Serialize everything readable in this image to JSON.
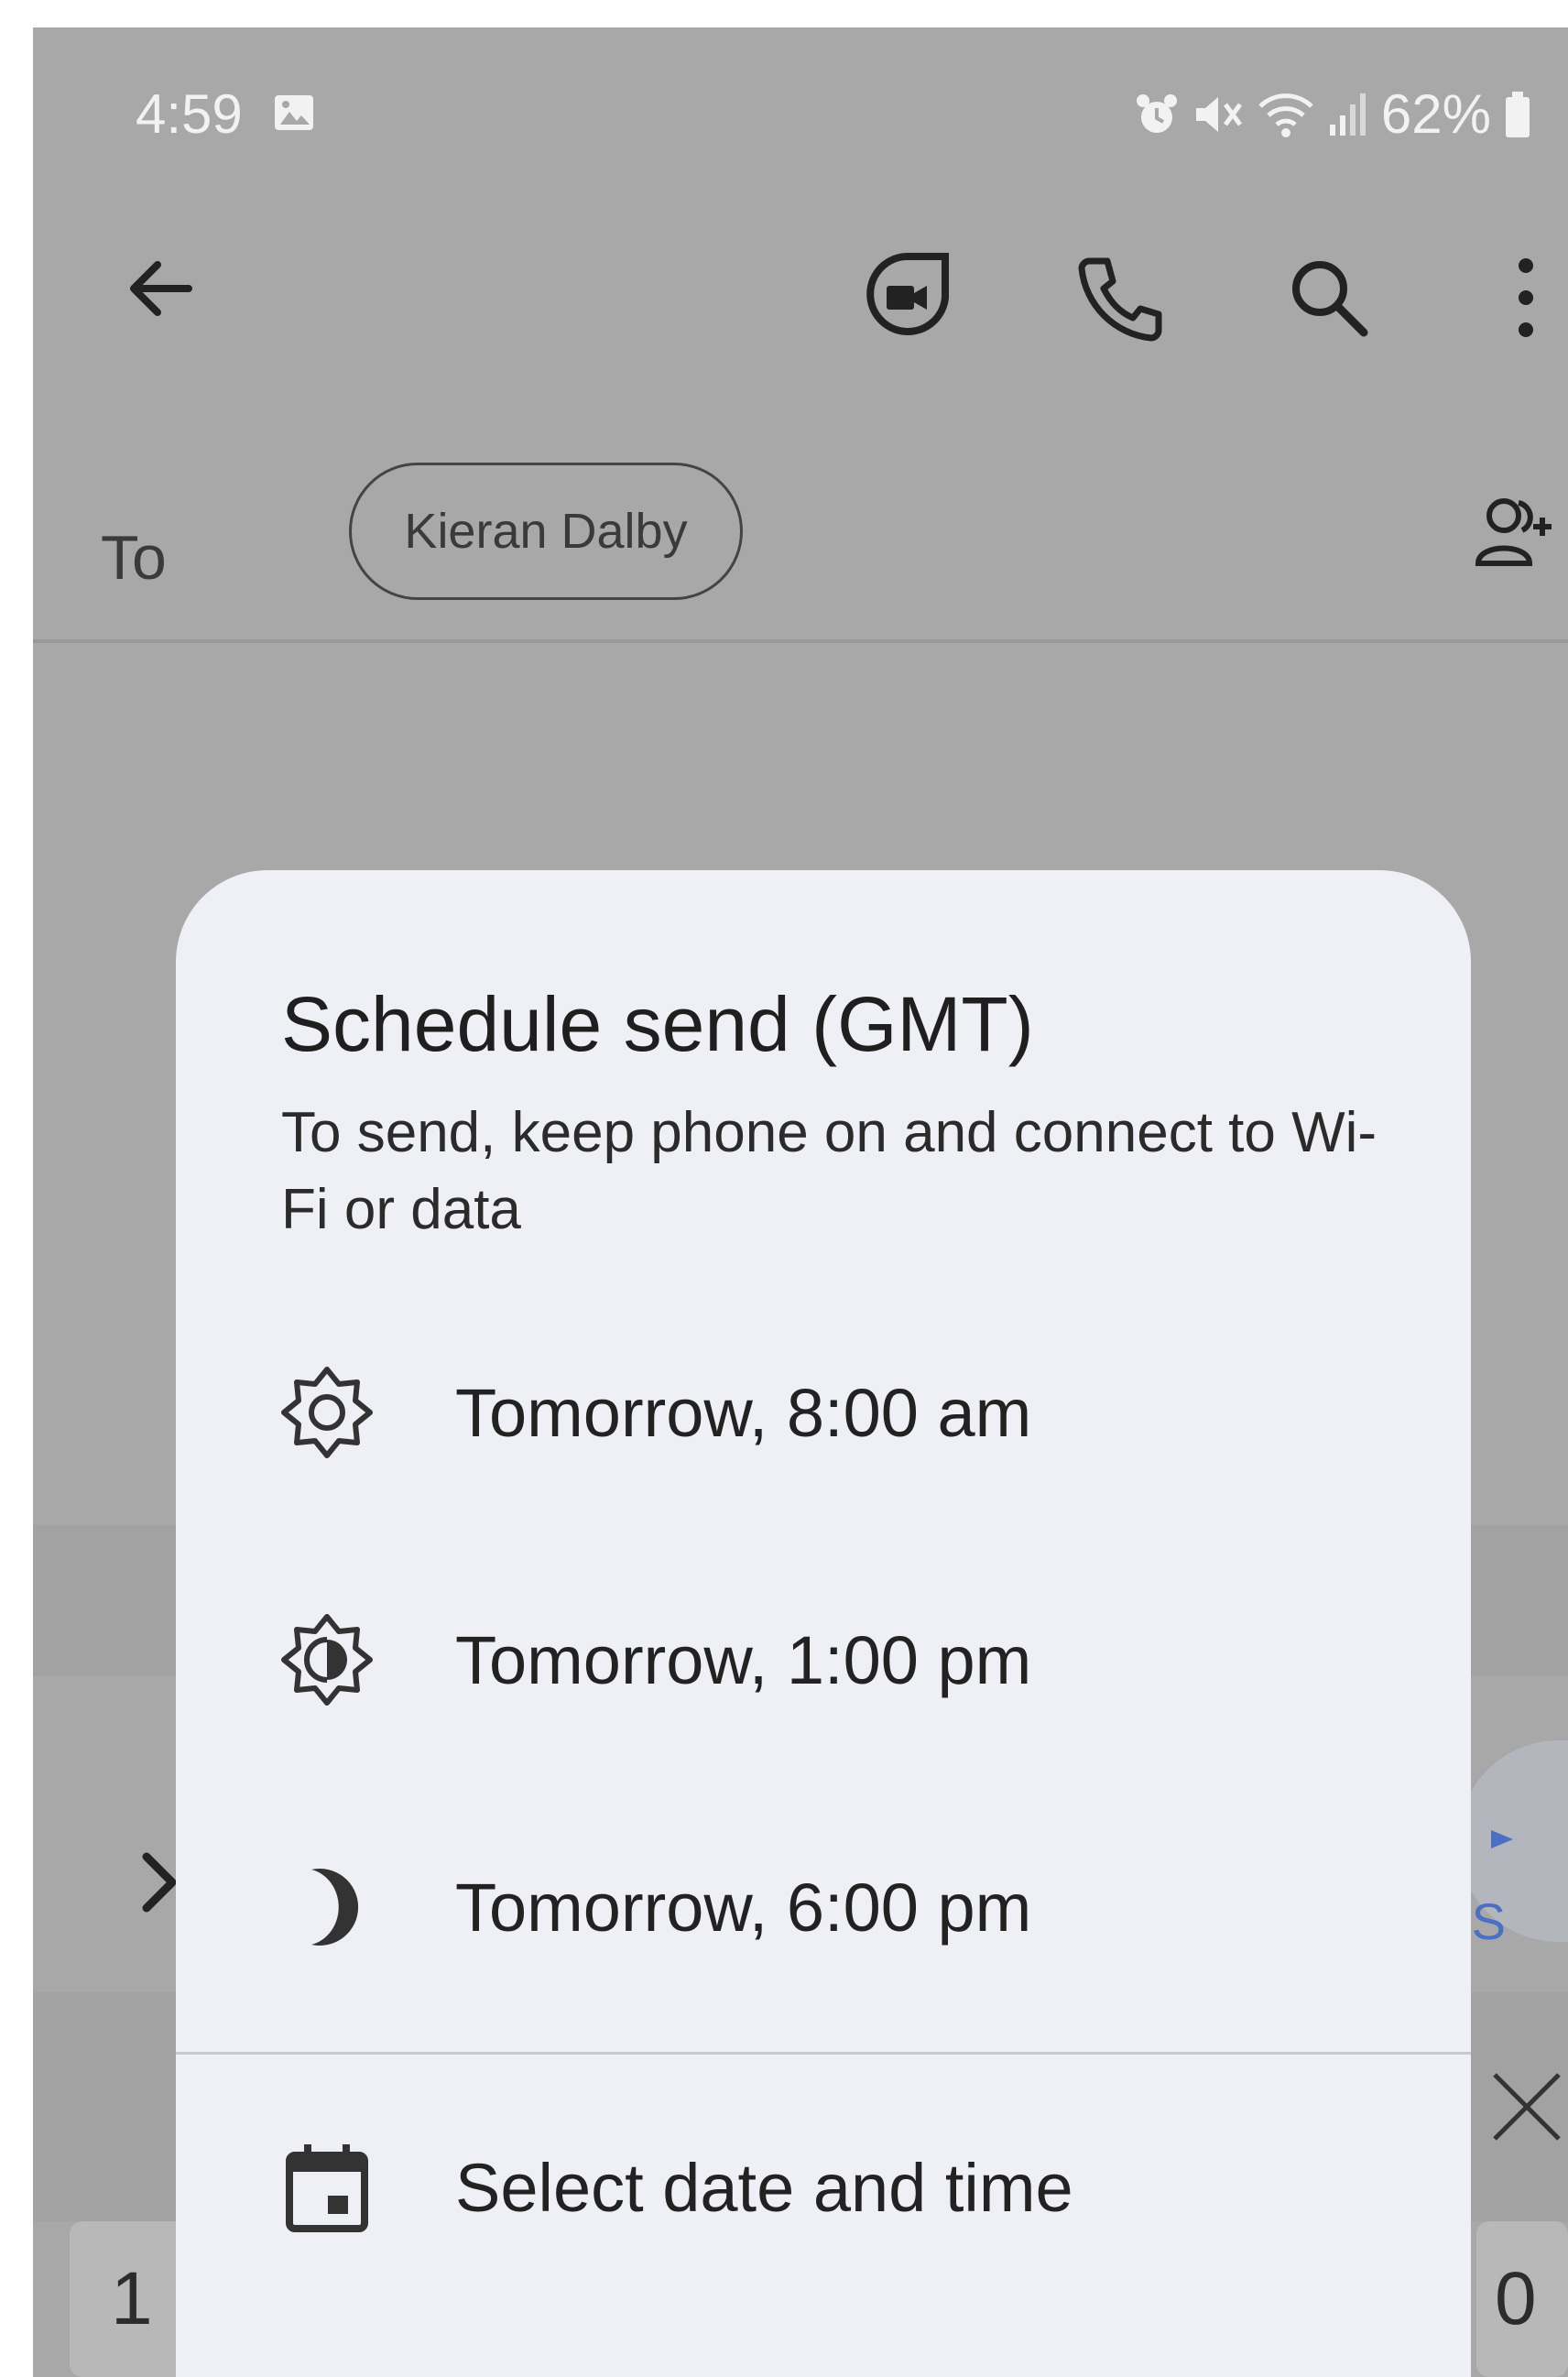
{
  "status_bar": {
    "time": "4:59",
    "battery": "62%",
    "icons": [
      "gallery-icon",
      "alarm-icon",
      "mute-icon",
      "wifi-icon",
      "signal-icon",
      "battery-icon"
    ]
  },
  "app_bar": {
    "icons": [
      "back-arrow-icon",
      "video-call-icon",
      "phone-icon",
      "search-icon",
      "more-vert-icon"
    ]
  },
  "recipient": {
    "to_label": "To",
    "chip_name": "Kieran Dalby"
  },
  "schedule_sheet": {
    "title": "Schedule send (GMT)",
    "subtitle": "To send, keep phone on and connect to Wi-Fi or data",
    "options": [
      {
        "label": "Tomorrow, 8:00 am",
        "icon": "sun-icon"
      },
      {
        "label": "Tomorrow, 1:00 pm",
        "icon": "half-sun-icon"
      },
      {
        "label": "Tomorrow, 6:00 pm",
        "icon": "moon-icon"
      },
      {
        "label": "Select date and time",
        "icon": "calendar-icon"
      }
    ]
  },
  "background": {
    "send_partial": "S",
    "key_left": "1",
    "key_right": "0"
  },
  "colors": {
    "scrim": "#a8a8a8",
    "sheet": "#eef0f5",
    "accent": "#4b6fc2"
  }
}
